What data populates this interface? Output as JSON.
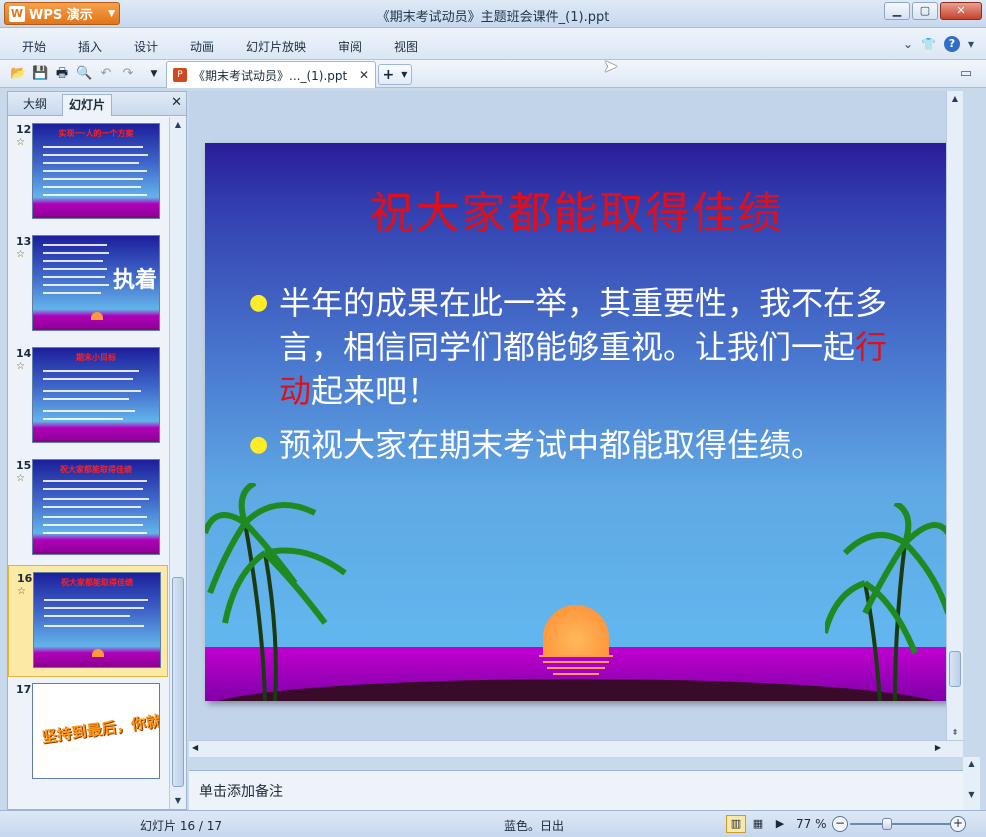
{
  "app": {
    "button_label": "WPS 演示",
    "window_title": "《期末考试动员》主题班会课件_(1).ppt"
  },
  "menu": {
    "items": [
      "开始",
      "插入",
      "设计",
      "动画",
      "幻灯片放映",
      "审阅",
      "视图"
    ]
  },
  "toolbar": {
    "doc_tab_label": "《期末考试动员》..._(1).ppt",
    "new_tab_label": "+"
  },
  "left_panel": {
    "tabs": [
      "大纲",
      "幻灯片"
    ],
    "active_tab": "幻灯片",
    "thumbnails": [
      {
        "number": "12",
        "title": "实现一·人的一个方案"
      },
      {
        "number": "13",
        "big_text": "执着"
      },
      {
        "number": "14",
        "title": "期末小目标"
      },
      {
        "number": "15",
        "title": "祝大家都能取得佳绩"
      },
      {
        "number": "16",
        "title": "祝大家都能取得佳绩",
        "selected": true
      },
      {
        "number": "17",
        "ribbon_text": "坚持到最后，你就是胜利的"
      }
    ]
  },
  "slide": {
    "title": "祝大家都能取得佳绩",
    "bullet1_before": "半年的成果在此一举，其重要性，我不在多言，相信同学们都能够重视。让我们一起",
    "bullet1_highlight": "行动",
    "bullet1_after": "起来吧！",
    "bullet2": "预视大家在期末考试中都能取得佳绩。",
    "colors": {
      "title": "#e0101a",
      "bullet_dot": "#ffeb2a",
      "highlight": "#e0101a"
    }
  },
  "notes": {
    "placeholder": "单击添加备注"
  },
  "status": {
    "slide_counter": "幻灯片 16 / 17",
    "theme": "蓝色。日出",
    "zoom": "77 %"
  }
}
